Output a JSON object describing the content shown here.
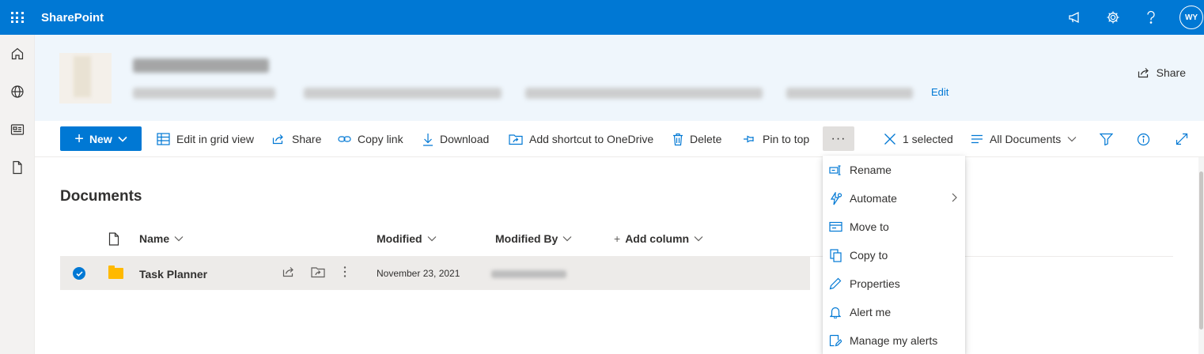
{
  "suite_bar": {
    "app_title": "SharePoint",
    "avatar_initials": "WY",
    "icons": [
      "waffle-icon",
      "megaphone-icon",
      "settings-icon",
      "help-icon"
    ]
  },
  "left_rail": {
    "icons": [
      "home-icon",
      "globe-icon",
      "news-icon",
      "document-icon"
    ]
  },
  "site_header": {
    "edit_label": "Edit",
    "share_label": "Share"
  },
  "command_bar": {
    "new_label": "New",
    "edit_grid_label": "Edit in grid view",
    "share_label": "Share",
    "copy_link_label": "Copy link",
    "download_label": "Download",
    "add_shortcut_label": "Add shortcut to OneDrive",
    "delete_label": "Delete",
    "pin_label": "Pin to top",
    "more_label": "···",
    "selected_label": "1 selected",
    "view_label": "All Documents"
  },
  "library": {
    "title": "Documents",
    "columns": {
      "name": "Name",
      "modified": "Modified",
      "modified_by": "Modified By",
      "add_column": "Add column"
    },
    "rows": [
      {
        "name": "Task Planner",
        "modified": "November 23, 2021",
        "selected": true
      }
    ]
  },
  "context_menu": {
    "items": [
      {
        "label": "Rename",
        "icon": "rename-icon"
      },
      {
        "label": "Automate",
        "icon": "automate-icon",
        "has_submenu": true
      },
      {
        "label": "Move to",
        "icon": "move-to-icon"
      },
      {
        "label": "Copy to",
        "icon": "copy-to-icon"
      },
      {
        "label": "Properties",
        "icon": "pencil-icon"
      },
      {
        "label": "Alert me",
        "icon": "bell-icon"
      },
      {
        "label": "Manage my alerts",
        "icon": "edit-alerts-icon"
      }
    ]
  },
  "colors": {
    "accent": "#0078d4",
    "suite_bar": "#0078d4",
    "header_bg": "#eff6fc",
    "selected_row": "#edebe9",
    "folder": "#ffb900"
  }
}
